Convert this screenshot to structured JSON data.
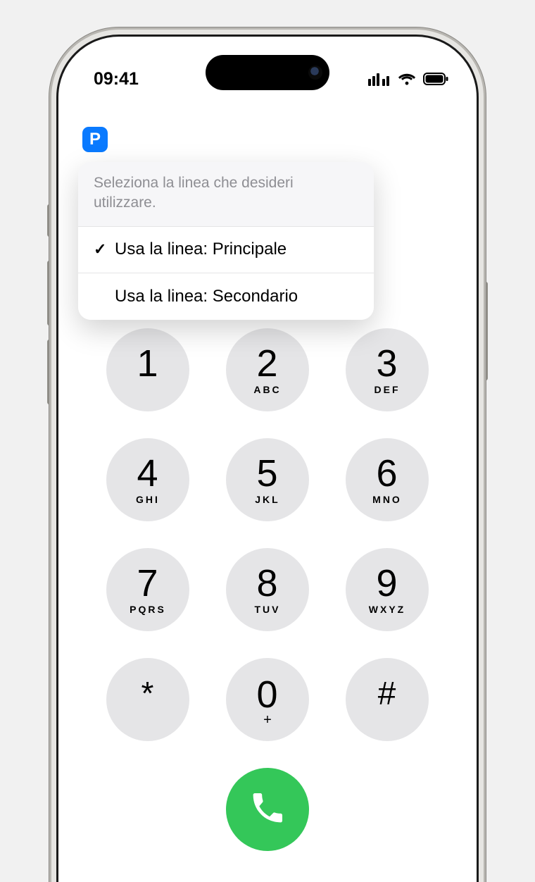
{
  "status": {
    "time": "09:41"
  },
  "line": {
    "badge": "P",
    "popover_title": "Seleziona la linea che desideri utilizzare.",
    "options": [
      {
        "label": "Usa la linea: Principale",
        "selected": true
      },
      {
        "label": "Usa la linea: Secondario",
        "selected": false
      }
    ]
  },
  "keypad": {
    "keys": [
      {
        "digit": "1",
        "letters": ""
      },
      {
        "digit": "2",
        "letters": "ABC"
      },
      {
        "digit": "3",
        "letters": "DEF"
      },
      {
        "digit": "4",
        "letters": "GHI"
      },
      {
        "digit": "5",
        "letters": "JKL"
      },
      {
        "digit": "6",
        "letters": "MNO"
      },
      {
        "digit": "7",
        "letters": "PQRS"
      },
      {
        "digit": "8",
        "letters": "TUV"
      },
      {
        "digit": "9",
        "letters": "WXYZ"
      },
      {
        "digit": "*",
        "letters": ""
      },
      {
        "digit": "0",
        "letters": "+"
      },
      {
        "digit": "#",
        "letters": ""
      }
    ]
  },
  "colors": {
    "accent": "#0a7aff",
    "call_green": "#34c759",
    "key_bg": "#e5e5e7"
  },
  "check_glyph": "✓"
}
